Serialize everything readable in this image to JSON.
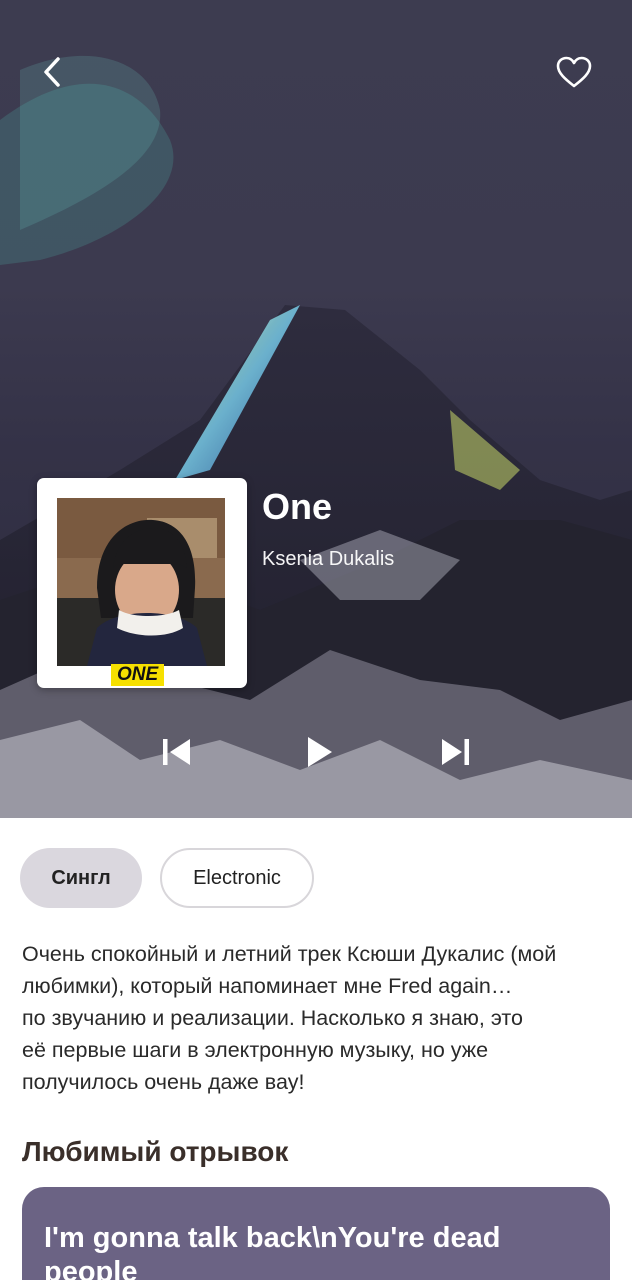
{
  "track": {
    "title": "One",
    "artist": "Ksenia Dukalis",
    "cover_badge": "ONE"
  },
  "header": {
    "back_icon": "chevron-left-icon",
    "favorite_icon": "heart-outline-icon"
  },
  "player": {
    "prev_icon": "skip-previous-icon",
    "play_icon": "play-icon",
    "next_icon": "skip-next-icon"
  },
  "tags": [
    {
      "label": "Сингл"
    },
    {
      "label": "Electronic"
    }
  ],
  "description": "Очень спокойный и летний трек Ксюши Дукалис (мой\nлюбимки), который напоминает мне Fred again…\nпо звучанию и реализации. Насколько я знаю, это\nеё первые шаги в электронную музыку, но уже\nполучилось очень даже вау!",
  "favorite_section": {
    "title": "Любимый отрывок",
    "quote": "I'm gonna talk back\\nYou're dead people"
  },
  "colors": {
    "accent_card": "#6b6384",
    "tag_primary_bg": "#dad7de",
    "badge_yellow": "#f6e000"
  }
}
